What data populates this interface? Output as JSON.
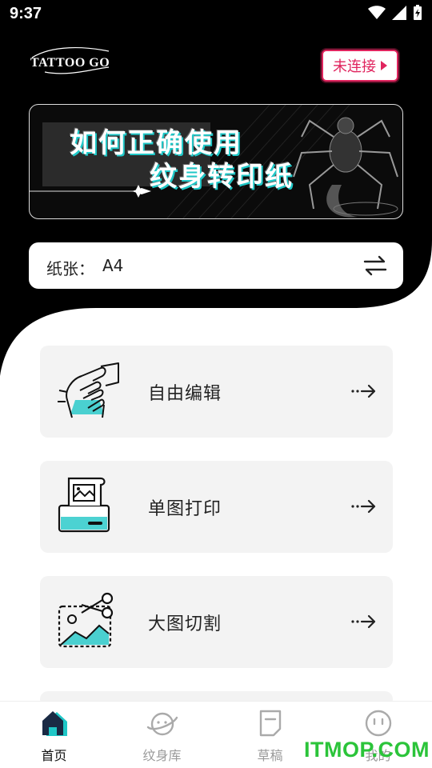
{
  "status_bar": {
    "time": "9:37"
  },
  "header": {
    "logo_text": "TATTOO GO",
    "connect_label": "未连接"
  },
  "banner": {
    "line1": "如何正确使用",
    "line2": "纹身转印纸"
  },
  "paper": {
    "label": "纸张：",
    "value": "A4"
  },
  "menu": [
    {
      "label": "自由编辑",
      "icon": "hand-edit-icon"
    },
    {
      "label": "单图打印",
      "icon": "printer-icon"
    },
    {
      "label": "大图切割",
      "icon": "scissors-cut-icon"
    }
  ],
  "tabs": [
    {
      "label": "首页",
      "icon": "home-icon",
      "active": true
    },
    {
      "label": "纹身库",
      "icon": "planet-icon",
      "active": false
    },
    {
      "label": "草稿",
      "icon": "draft-icon",
      "active": false
    },
    {
      "label": "我的",
      "icon": "profile-icon",
      "active": false
    }
  ],
  "watermark": "ITMOP.COM",
  "colors": {
    "accent_red": "#e0245e",
    "accent_cyan": "#1fc7c7",
    "header_bg": "#000000",
    "card_bg": "#f3f3f3"
  }
}
